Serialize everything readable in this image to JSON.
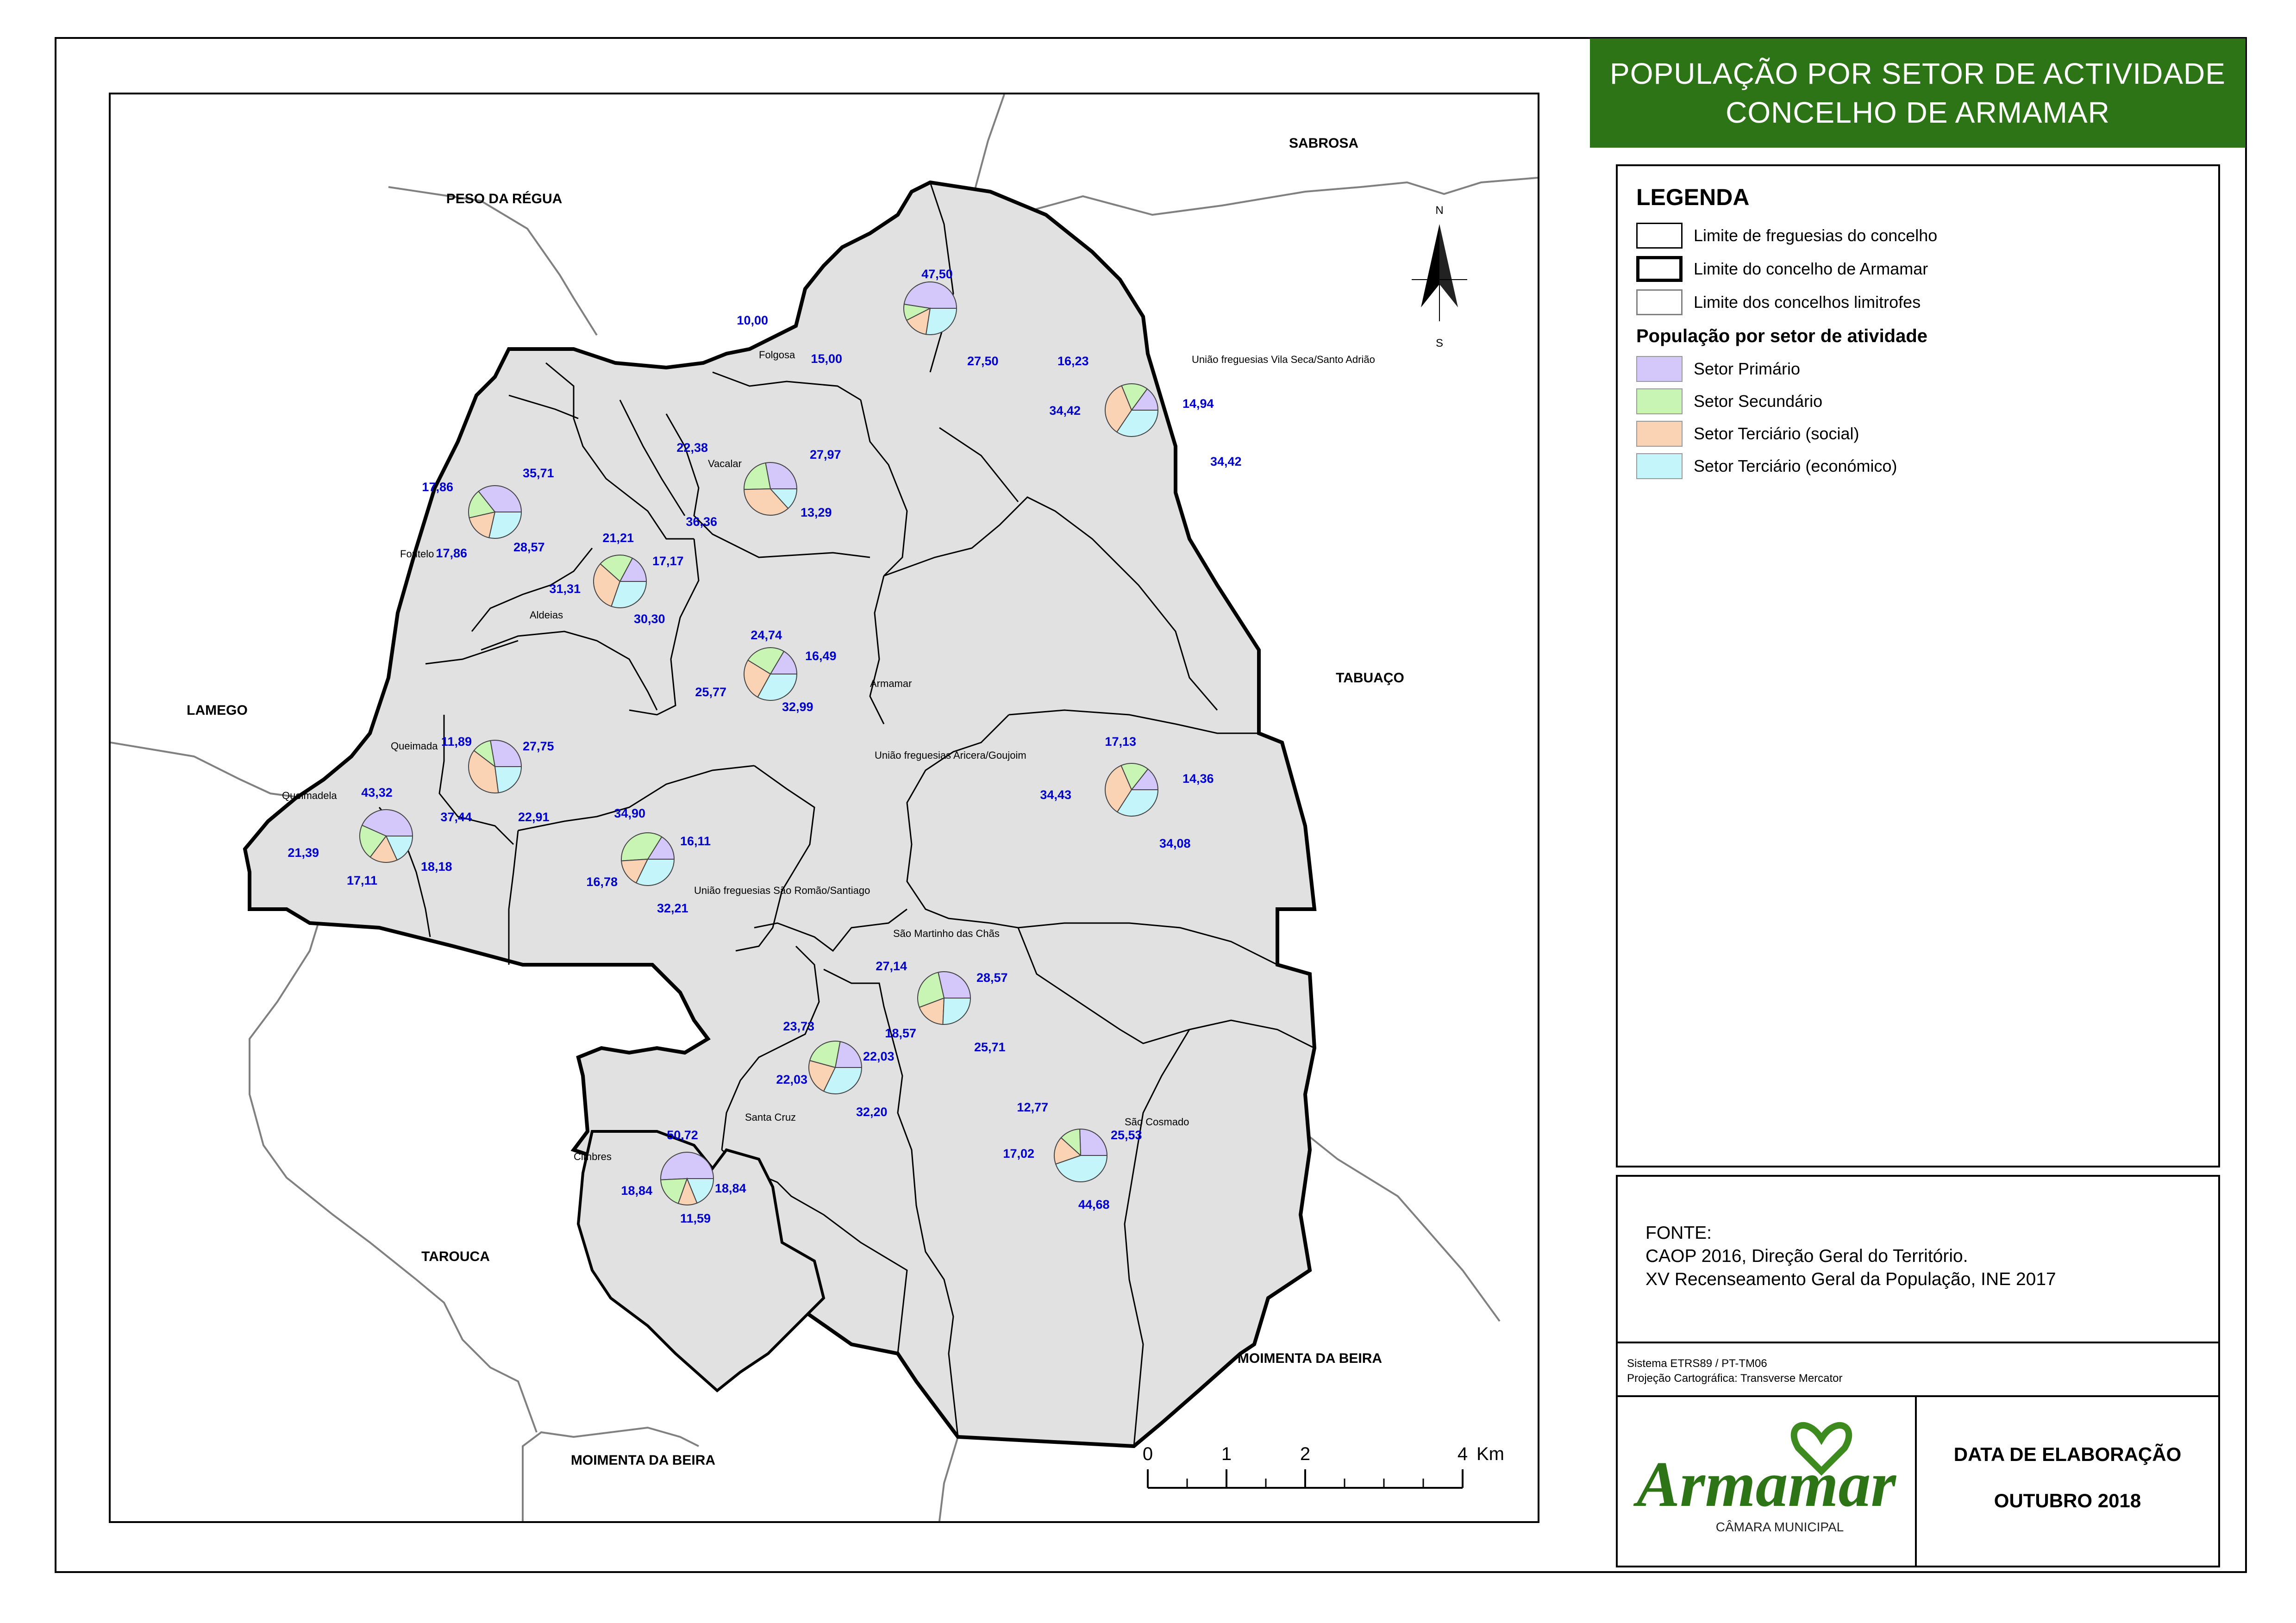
{
  "title": {
    "line1": "POPULAÇÃO POR SETOR DE ACTIVIDADE",
    "line2": "CONCELHO DE ARMAMAR"
  },
  "legend": {
    "heading": "LEGENDA",
    "line_items": [
      {
        "label": "Limite de freguesias do concelho"
      },
      {
        "label": "Limite do concelho de Armamar"
      },
      {
        "label": "Limite dos concelhos limitrofes"
      }
    ],
    "sector_heading": "População por setor de atividade",
    "sectors": [
      {
        "label": "Setor Primário",
        "color": "#d4c8fa"
      },
      {
        "label": "Setor Secundário",
        "color": "#c8f5b4"
      },
      {
        "label": "Setor Terciário (social)",
        "color": "#fad2b4"
      },
      {
        "label": "Setor Terciário (económico)",
        "color": "#c4f5fa"
      }
    ]
  },
  "source": {
    "heading": "FONTE:",
    "line1": "CAOP 2016, Direção Geral do Território.",
    "line2": "XV Recenseamento Geral da População, INE 2017"
  },
  "srs": {
    "line1": "Sistema ETRS89 / PT-TM06",
    "line2": "Projeção Cartográfica: Transverse Mercator"
  },
  "logo": {
    "name": "Armamar",
    "subtitle": "CÂMARA MUNICIPAL"
  },
  "date": {
    "label": "DATA DE ELABORAÇÃO",
    "value": "OUTUBRO 2018"
  },
  "map": {
    "colors": {
      "parish_fill": "#e1e1e1",
      "label_blue": "#0000cc",
      "neighbor_line": "#808080"
    },
    "compass": {
      "north": "N",
      "south": "S"
    },
    "scale_bar": {
      "ticks": [
        "0",
        "1",
        "2",
        "4"
      ],
      "unit": "Km"
    },
    "neighbors": [
      {
        "name": "SABROSA"
      },
      {
        "name": "PESO DA RÉGUA"
      },
      {
        "name": "LAMEGO"
      },
      {
        "name": "TABUAÇO"
      },
      {
        "name": "TAROUCA"
      },
      {
        "name": "MOIMENTA DA BEIRA"
      },
      {
        "name": "MOIMENTA DA BEIRA"
      }
    ],
    "parishes": [
      {
        "name": "Folgosa",
        "values": [
          "47,50",
          "10,00",
          "15,00",
          "27,50"
        ]
      },
      {
        "name": "União freguesias Vila Seca/Santo Adrião",
        "values": [
          "14,94",
          "16,23",
          "34,42",
          "34,42"
        ]
      },
      {
        "name": "Vacalar",
        "values": [
          "27,97",
          "22,38",
          "36,36",
          "13,29"
        ]
      },
      {
        "name": "Fontelo",
        "values": [
          "35,71",
          "17,86",
          "17,86",
          "28,57"
        ]
      },
      {
        "name": "Aldeias",
        "values": [
          "17,17",
          "21,21",
          "31,31",
          "30,30"
        ]
      },
      {
        "name": "Armamar",
        "values": [
          "16,49",
          "24,74",
          "25,77",
          "32,99"
        ]
      },
      {
        "name": "Queimada",
        "values": [
          "27,75",
          "11,89",
          "37,44",
          "22,91"
        ]
      },
      {
        "name": "Queimadela",
        "values": [
          "43,32",
          "21,39",
          "17,11",
          "18,18"
        ]
      },
      {
        "name": "União freguesias São Romão/Santiago",
        "values": [
          "16,11",
          "34,90",
          "16,78",
          "32,21"
        ]
      },
      {
        "name": "União freguesias Aricera/Goujoim",
        "values": [
          "14,36",
          "17,13",
          "34,43",
          "34,08"
        ]
      },
      {
        "name": "São Martinho das Chãs",
        "values": [
          "28,57",
          "27,14",
          "18,57",
          "25,71"
        ]
      },
      {
        "name": "Santa Cruz",
        "values": [
          "22,03",
          "23,73",
          "22,03",
          "32,20"
        ]
      },
      {
        "name": "São Cosmado",
        "values": [
          "25,53",
          "12,77",
          "17,02",
          "44,68"
        ]
      },
      {
        "name": "Cimbres",
        "values": [
          "50,72",
          "18,84",
          "11,59",
          "18,84"
        ]
      }
    ]
  }
}
